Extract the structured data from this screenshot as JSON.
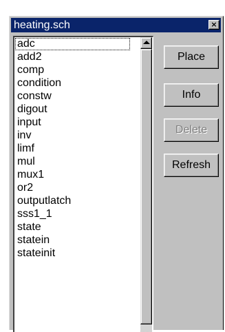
{
  "window": {
    "title": "heating.sch",
    "close_label": "×"
  },
  "list": {
    "items": [
      "adc",
      "add2",
      "comp",
      "condition",
      "constw",
      "digout",
      "input",
      "inv",
      "limf",
      "mul",
      "mux1",
      "or2",
      "outputlatch",
      "sss1_1",
      "state",
      "statein",
      "stateinit"
    ],
    "focused_index": 0
  },
  "buttons": {
    "place": "Place",
    "info": "Info",
    "delete": "Delete",
    "refresh": "Refresh"
  },
  "colors": {
    "titlebar": "#0a246a",
    "face": "#c0c0c0",
    "disabled_text": "#808080"
  },
  "icons": {
    "scroll_up": "arrow-up-icon"
  }
}
